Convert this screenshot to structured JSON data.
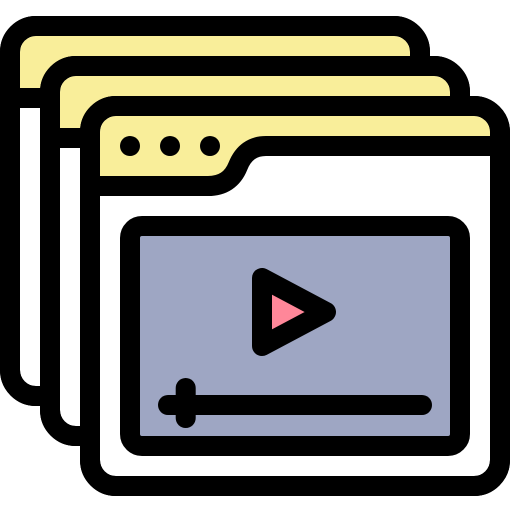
{
  "icon": {
    "name": "stacked-video-player-windows-icon",
    "window_count": 3,
    "video_progress": 0.05
  },
  "colors": {
    "outline": "#000000",
    "title_bar": "#f9ee9a",
    "window_body": "#ffffff",
    "video_screen": "#9ea6c3",
    "play_button": "#ff8799"
  }
}
